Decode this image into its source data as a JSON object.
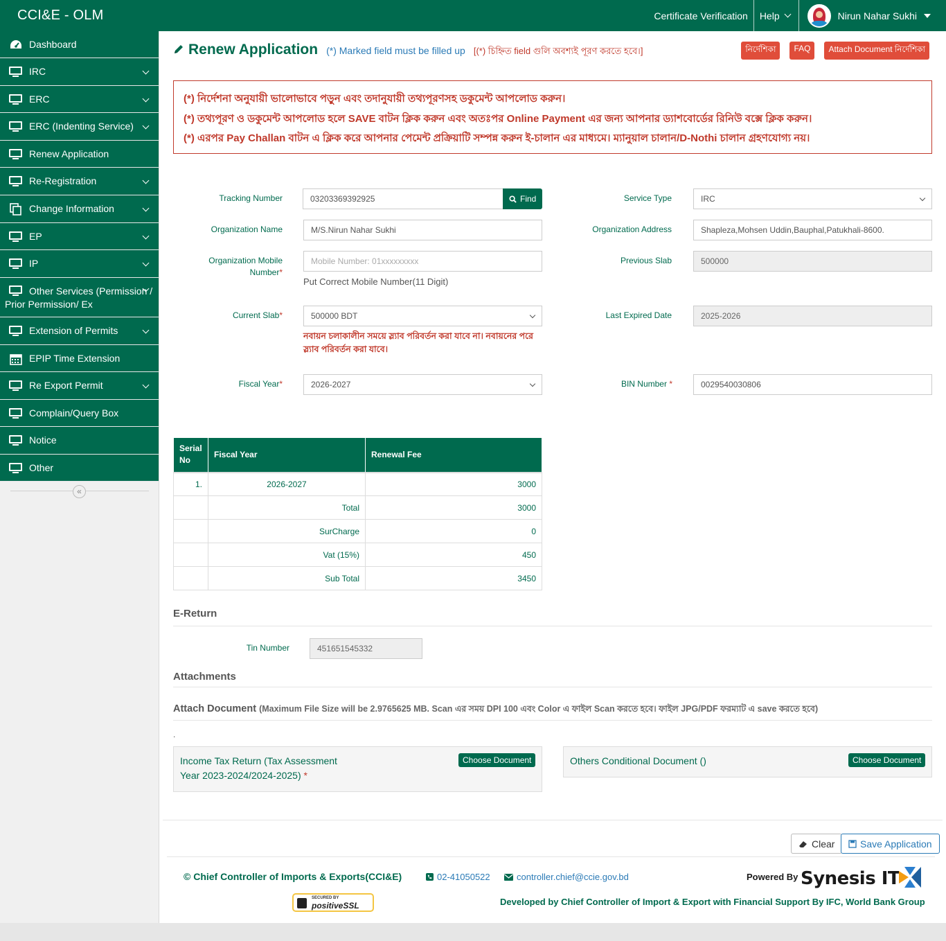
{
  "header": {
    "brand": "CCI&E - OLM",
    "cert_verification": "Certificate Verification",
    "help": "Help",
    "user_name": "Nirun Nahar Sukhi"
  },
  "sidebar": {
    "items": [
      {
        "label": "Dashboard",
        "icon": "dashboard-icon",
        "has_children": false
      },
      {
        "label": "IRC",
        "icon": "monitor-icon",
        "has_children": true
      },
      {
        "label": "ERC",
        "icon": "monitor-icon",
        "has_children": true
      },
      {
        "label": "ERC (Indenting Service)",
        "icon": "monitor-icon",
        "has_children": true
      },
      {
        "label": "Renew Application",
        "icon": "monitor-icon",
        "has_children": false
      },
      {
        "label": "Re-Registration",
        "icon": "monitor-icon",
        "has_children": true
      },
      {
        "label": "Change Information",
        "icon": "copy-icon",
        "has_children": true
      },
      {
        "label": "EP",
        "icon": "monitor-icon",
        "has_children": true
      },
      {
        "label": "IP",
        "icon": "monitor-icon",
        "has_children": true
      },
      {
        "label": "Other Services (Permission / Prior Permission/ Ex",
        "icon": "monitor-icon",
        "has_children": true
      },
      {
        "label": "Extension of Permits",
        "icon": "monitor-icon",
        "has_children": true
      },
      {
        "label": "EPIP Time Extension",
        "icon": "calendar-icon",
        "has_children": false
      },
      {
        "label": "Re Export Permit",
        "icon": "monitor-icon",
        "has_children": true
      },
      {
        "label": "Complain/Query Box",
        "icon": "monitor-icon",
        "has_children": false
      },
      {
        "label": "Notice",
        "icon": "monitor-icon",
        "has_children": false
      },
      {
        "label": "Other",
        "icon": "monitor-icon",
        "has_children": false
      }
    ]
  },
  "page": {
    "title": "Renew Application",
    "hint_en": "(*) Marked field must be filled up",
    "hint_bn": "[(*) চিহ্নিত field গুলি অবশ্যই পূরণ করতে হবে।]",
    "btn_guide": "নির্দেশিকা",
    "btn_faq": "FAQ",
    "btn_attach_guide": "Attach Document নির্দেশিকা"
  },
  "notice": {
    "line1": "(*) নির্দেশনা অনুযায়ী ভালোভাবে পড়ুন এবং তদানুযায়ী তথ্যপূরণসহ ডকুমেন্ট আপলোড করুন।",
    "line2": "(*) তথ্যপূরণ ও ডকুমেন্ট আপলোড হলে SAVE বাটন ক্লিক করুন এবং অতঃপর Online Payment এর জন্য আপনার ড্যাশবোর্ডের রিনিউ বক্সে ক্লিক করুন।",
    "line3": "(*) এরপর Pay Challan বাটন এ ক্লিক করে আপনার পেমেন্ট প্রক্রিয়াটি সম্পন্ন করুন ই-চালান এর মাধ্যমে। ম্যানুয়াল চালান/D-Nothi চালান গ্রহণযোগ্য নয়।"
  },
  "form": {
    "tracking_label": "Tracking Number",
    "tracking_value": "03203369392925",
    "find_label": "Find",
    "service_type_label": "Service Type",
    "service_type_value": "IRC",
    "org_name_label": "Organization Name",
    "org_name_value": "M/S.Nirun Nahar Sukhi",
    "org_address_label": "Organization Address",
    "org_address_value": "Shapleza,Mohsen Uddin,Bauphal,Patukhali-8600.",
    "org_mobile_label_1": "Organization Mobile",
    "org_mobile_label_2": "Number",
    "org_mobile_placeholder": "Mobile Number: 01xxxxxxxxx",
    "org_mobile_help": "Put Correct Mobile Number(11 Digit)",
    "previous_slab_label": "Previous Slab",
    "previous_slab_value": "500000",
    "current_slab_label": "Current Slab",
    "current_slab_value": "500000 BDT",
    "slab_warning_1": "নবায়ন চলাকালীন সময়ে স্ল্যাব পরিবর্তন করা যাবে না। নবায়নের পরে",
    "slab_warning_2": "স্ল্যাব পরিবর্তন করা যাবে।",
    "last_expired_label": "Last Expired Date",
    "last_expired_value": "2025-2026",
    "fiscal_year_label": "Fiscal Year",
    "fiscal_year_value": "2026-2027",
    "bin_label": "BIN Number",
    "bin_value": "0029540030806"
  },
  "fee_table": {
    "headers": [
      "Serial No",
      "Fiscal Year",
      "Renewal Fee"
    ],
    "header_serial_1": "Serial",
    "header_serial_2": "No",
    "row": {
      "serial": "1.",
      "fiscal_year": "2026-2027",
      "fee": "3000"
    },
    "total_label": "Total",
    "total_value": "3000",
    "surcharge_label": "SurCharge",
    "surcharge_value": "0",
    "vat_label": "Vat (15%)",
    "vat_value": "450",
    "subtotal_label": "Sub Total",
    "subtotal_value": "3450"
  },
  "ereturn": {
    "title": "E-Return",
    "tin_label": "Tin Number",
    "tin_value": "451651545332"
  },
  "attachments": {
    "title": "Attachments",
    "attach_doc": "Attach Document",
    "attach_note": "(Maximum File Size will be 2.9765625 MB. Scan এর সময় DPI 100 এবং Color এ ফাইল Scan করতে হবে। ফাইল JPG/PDF ফরম্যাট এ save করতে হবে)",
    "dot": ".",
    "doc1_label_1": "Income Tax Return (Tax Assessment",
    "doc1_label_2": "Year 2023-2024/2024-2025)",
    "doc2_label": "Others Conditional Document ()",
    "choose_label": "Choose Document"
  },
  "actions": {
    "clear": "Clear",
    "save": "Save Application"
  },
  "footer": {
    "copyright": "© Chief Controller of Imports & Exports(CCI&E)",
    "phone": "02-41050522",
    "email": "controller.chief@ccie.gov.bd",
    "powered_by": "Powered By",
    "synesis": "Synesis IT",
    "ssl_top": "SECURED BY",
    "ssl_brand": "positiveSSL",
    "developed_by": "Developed by Chief Controller of Import & Export with Financial Support By IFC, World Bank Group"
  },
  "colors": {
    "primary_green": "#006a4e",
    "alert_red": "#c0392b",
    "link_blue": "#2a7ab6",
    "button_red": "#e04d3a"
  }
}
